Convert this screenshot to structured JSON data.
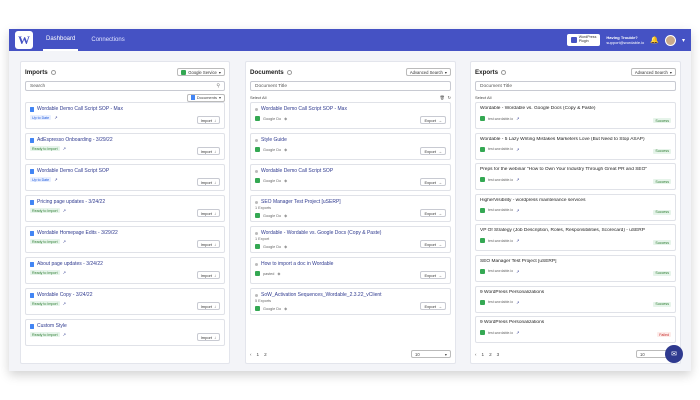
{
  "nav": {
    "logo": "W",
    "tabs": [
      "Dashboard",
      "Connections"
    ],
    "plugin_label_1": "WordPress",
    "plugin_label_2": "Plugin",
    "help_title": "Having Trouble?",
    "help_email": "support@wordable.io"
  },
  "imports": {
    "title": "Imports",
    "source_select": "Google Service",
    "search_placeholder": "Search",
    "docs_select": "Documents",
    "import_label": "Import",
    "items": [
      {
        "title": "Wordable Demo Call Script SOP - Max",
        "badge": "Up to Date",
        "badge_type": "blue"
      },
      {
        "title": "AdEspresso Onboarding - 3/29/22",
        "badge": "Ready to Import",
        "badge_type": "ok"
      },
      {
        "title": "Wordable Demo Call Script SOP",
        "badge": "Up to Date",
        "badge_type": "blue"
      },
      {
        "title": "Pricing page updates - 3/24/22",
        "badge": "Ready to Import",
        "badge_type": "ok"
      },
      {
        "title": "Wordable Homepage Edits - 3/29/22",
        "badge": "Ready to Import",
        "badge_type": "ok"
      },
      {
        "title": "About page updates - 3/24/22",
        "badge": "Ready to Import",
        "badge_type": "ok"
      },
      {
        "title": "Wordable Copy - 3/24/22",
        "badge": "Ready to Import",
        "badge_type": "ok"
      },
      {
        "title": "Custom Style",
        "badge": "Ready to Import",
        "badge_type": "ok"
      }
    ]
  },
  "documents": {
    "title": "Documents",
    "search_select": "Advanced Search",
    "search_placeholder": "Document Title",
    "select_all": "Select All",
    "export_label": "Export",
    "items": [
      {
        "title": "Wordable Demo Call Script SOP - Max",
        "source": "Google Do"
      },
      {
        "title": "Style Guide",
        "source": "Google Do"
      },
      {
        "title": "Wordable Demo Call Script SOP",
        "source": "Google Do"
      },
      {
        "title": "SEO Manager Test Project [uSERP]",
        "source": "Google Do",
        "sub": "1 Exports"
      },
      {
        "title": "Wordable - Wordable vs. Google Docs (Copy & Paste)",
        "source": "Google Do",
        "sub": "1 Export"
      },
      {
        "title": "How to import a doc in Wordable",
        "source": "pasted"
      },
      {
        "title": "SoW_Activation Sequences_Wordable_2.3.22_vClient",
        "source": "Google Do",
        "sub": "5 Exports"
      }
    ],
    "pages": [
      "1",
      "2"
    ],
    "per_page": "10"
  },
  "exports": {
    "title": "Exports",
    "search_select": "Advanced Search",
    "search_placeholder": "Document Title",
    "select_all": "Select All",
    "site": "test.wordable.io",
    "items": [
      {
        "title": "Wordable - Wordable vs. Google Docs (Copy & Paste)",
        "status": "Success",
        "status_type": "success"
      },
      {
        "title": "Wordable - 5 Lazy Writing Mistakes Marketers Love (But Need to Stop ASAP)",
        "status": "Success",
        "status_type": "success"
      },
      {
        "title": "Preps for the webinar \"How to Own Your Industry Through Great PR and SEO\"",
        "status": "Success",
        "status_type": "success"
      },
      {
        "title": "HigherVisibility - wordpress maintenance services",
        "status": "Success",
        "status_type": "success"
      },
      {
        "title": "VP Of Strategy (Job Description, Roles, Responsibilities, Scorecard) - uSERP",
        "status": "Success",
        "status_type": "success"
      },
      {
        "title": "SEO Manager Test Project [uSERP]",
        "status": "Success",
        "status_type": "success"
      },
      {
        "title": "9 WordPress Personalizations",
        "status": "Success",
        "status_type": "success"
      },
      {
        "title": "9 WordPress Personalizations",
        "status": "Failed",
        "status_type": "failed"
      }
    ],
    "pages": [
      "1",
      "2",
      "3"
    ],
    "per_page": "10"
  },
  "colors": {
    "brand": "#4552c4",
    "accent": "#2f3a8f",
    "success": "#2e7d32",
    "failed": "#c62828"
  }
}
